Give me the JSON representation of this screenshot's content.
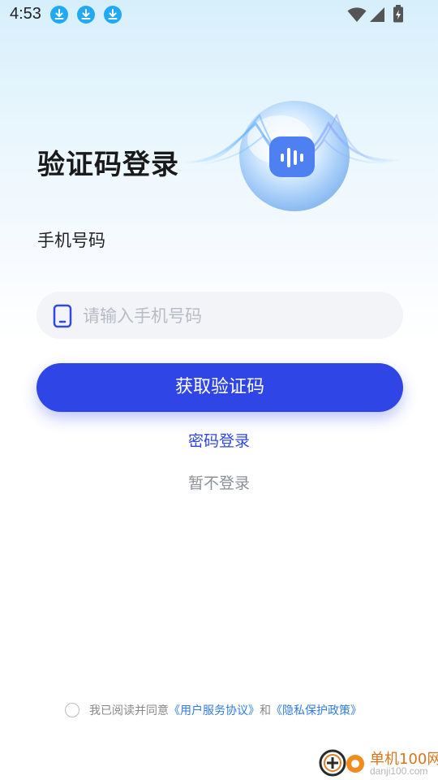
{
  "status_bar": {
    "time": "4:53",
    "notification_icons": [
      "download-icon",
      "download-icon",
      "download-icon"
    ],
    "system_icons": [
      "wifi-icon",
      "signal-icon",
      "battery-icon"
    ]
  },
  "title": "验证码登录",
  "phone_label": "手机号码",
  "phone_input": {
    "value": "",
    "placeholder": "请输入手机号码",
    "icon": "phone-icon"
  },
  "primary_button": "获取验证码",
  "password_login_link": "密码登录",
  "skip_login_link": "暂不登录",
  "agreement": {
    "checked": false,
    "prefix": "我已阅读并同意",
    "user_agreement": "《用户服务协议》",
    "conjunction": "和",
    "privacy_policy": "《隐私保护政策》"
  },
  "watermark": {
    "brand": "单机100网",
    "domain": "danji100.com"
  },
  "colors": {
    "accent": "#2f45e6",
    "link": "#2f7be0",
    "notification": "#21a9f3"
  }
}
